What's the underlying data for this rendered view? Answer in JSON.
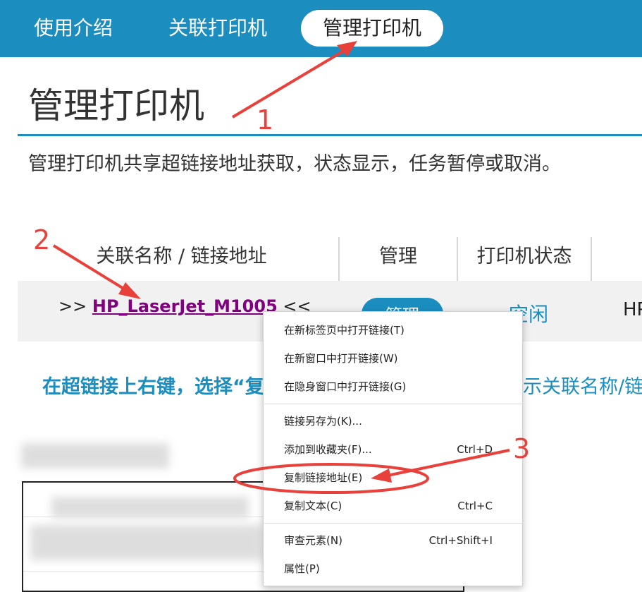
{
  "nav": {
    "items": [
      {
        "label": "使用介绍"
      },
      {
        "label": "关联打印机"
      },
      {
        "label": "管理打印机",
        "active": true
      }
    ]
  },
  "page": {
    "title": "管理打印机",
    "description": "管理打印机共享超链接地址获取，状态显示，任务暂停或取消。"
  },
  "table": {
    "headers": [
      "关联名称 / 链接地址",
      "管理",
      "打印机状态"
    ],
    "row": {
      "prefix": ">>",
      "link": "HP_LaserJet_M1005",
      "suffix": "<<",
      "manage_label": "管理",
      "status": "空闲",
      "extra": "HP"
    }
  },
  "hint": {
    "left": "在超链接上右键，选择“复",
    "right": "示关联名称/链"
  },
  "context_menu": {
    "items": [
      {
        "label": "在新标签页中打开链接(T)",
        "shortcut": ""
      },
      {
        "label": "在新窗口中打开链接(W)",
        "shortcut": ""
      },
      {
        "label": "在隐身窗口中打开链接(G)",
        "shortcut": ""
      },
      {
        "label": "链接另存为(K)...",
        "shortcut": ""
      },
      {
        "label": "添加到收藏夹(F)...",
        "shortcut": "Ctrl+D"
      },
      {
        "label": "复制链接地址(E)",
        "shortcut": ""
      },
      {
        "label": "复制文本(C)",
        "shortcut": "Ctrl+C"
      },
      {
        "label": "审查元素(N)",
        "shortcut": "Ctrl+Shift+I"
      },
      {
        "label": "属性(P)",
        "shortcut": ""
      }
    ]
  },
  "annotations": {
    "step1": "1",
    "step2": "2",
    "step3": "3",
    "color": "#e8403a"
  },
  "colors": {
    "brand": "#1b8ebf",
    "link_visited": "#800080"
  }
}
